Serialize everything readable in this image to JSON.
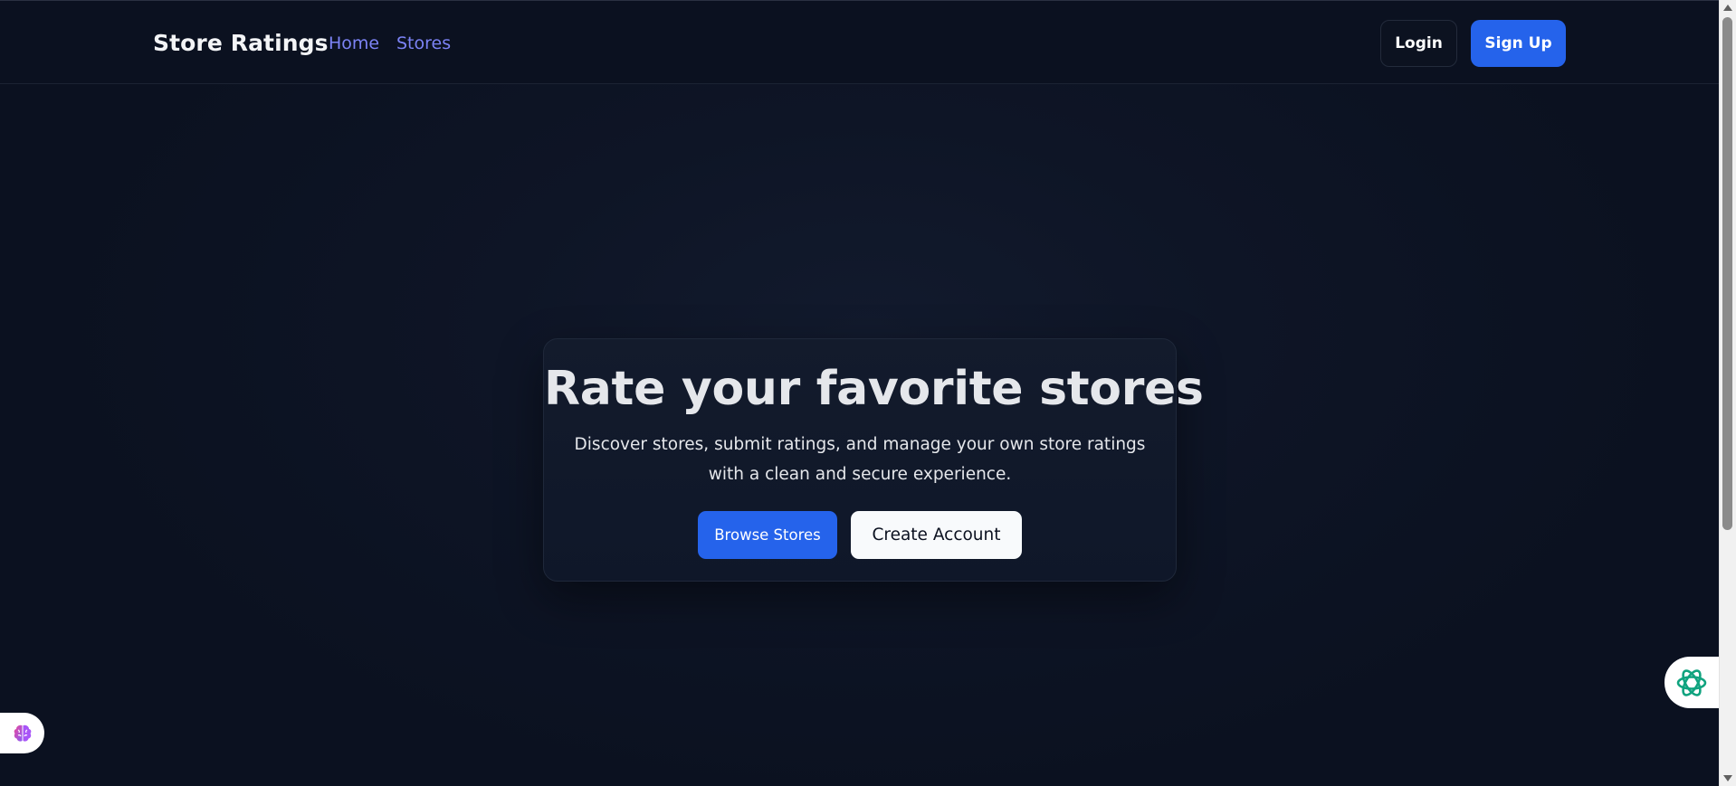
{
  "header": {
    "brand": "Store Ratings",
    "nav": [
      {
        "label": "Home"
      },
      {
        "label": "Stores"
      }
    ],
    "login_label": "Login",
    "signup_label": "Sign Up"
  },
  "hero": {
    "title": "Rate your favorite stores",
    "subtitle": "Discover stores, submit ratings, and manage your own store ratings with a clean and secure experience.",
    "browse_label": "Browse Stores",
    "create_label": "Create Account"
  },
  "widgets": {
    "left_icon": "brain-icon",
    "right_icon": "ai-assistant-icon"
  },
  "colors": {
    "background": "#0b1120",
    "accent": "#2563eb",
    "nav_link": "#7c83f5",
    "text": "#e5e7eb"
  }
}
